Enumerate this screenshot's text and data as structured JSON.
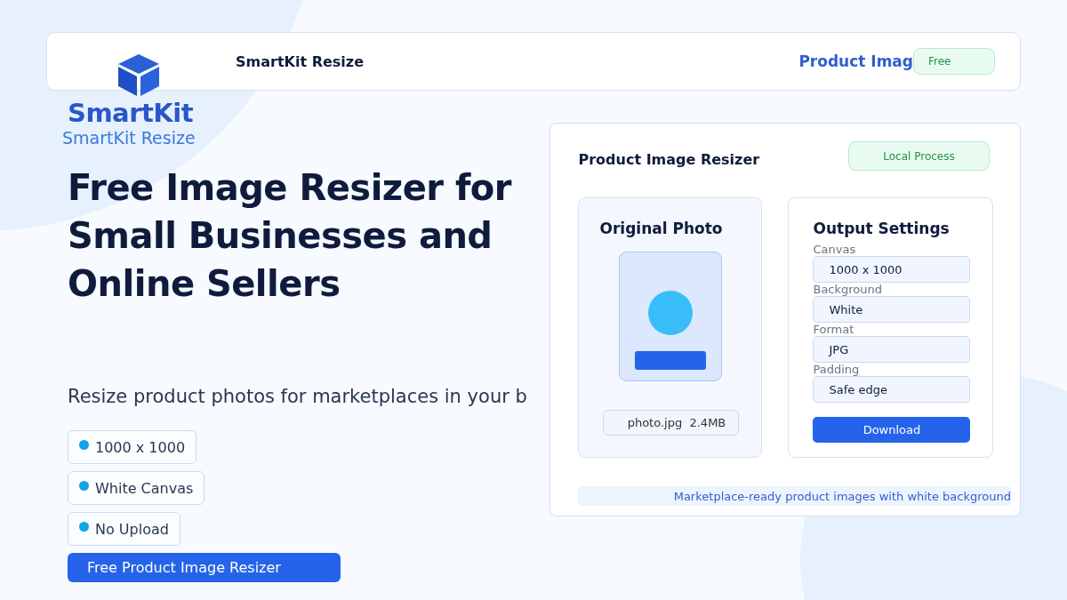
{
  "header": {
    "brand": "SmartKit Resize",
    "nav_link": "Product Imag",
    "badge": "Free"
  },
  "logo": {
    "wordmark": "SmartKit",
    "tagline": "SmartKit Resize"
  },
  "hero": {
    "title": "Free Image Resizer for Small Businesses and Online Sellers",
    "subtitle": "Resize product photos for marketplaces in your b",
    "features": [
      "1000 x 1000",
      "White Canvas",
      "No Upload"
    ],
    "cta": "Free Product Image Resizer"
  },
  "card": {
    "title": "Product Image Resizer",
    "badge": "Local Process",
    "original": {
      "title": "Original Photo",
      "file": "photo.jpg  2.4MB"
    },
    "settings": {
      "title": "Output Settings",
      "fields": [
        {
          "label": "Canvas",
          "value": "1000 x 1000"
        },
        {
          "label": "Background",
          "value": "White"
        },
        {
          "label": "Format",
          "value": "JPG"
        },
        {
          "label": "Padding",
          "value": "Safe edge"
        }
      ],
      "button": "Download"
    },
    "footer": "Marketplace-ready product images with white background"
  }
}
